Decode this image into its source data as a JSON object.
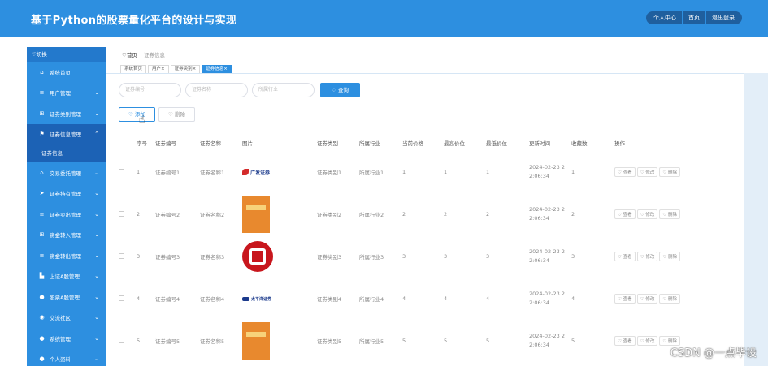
{
  "header": {
    "title": "基于Python的股票量化平台的设计与实现",
    "actions": [
      "个人中心",
      "首页",
      "退出登录"
    ]
  },
  "sidebar": {
    "switch_label": "♡切换",
    "items": [
      {
        "label": "系统首页",
        "icon": "home-icon"
      },
      {
        "label": "用户管理",
        "icon": "list-icon"
      },
      {
        "label": "证券类别管理",
        "icon": "grid-icon"
      },
      {
        "label": "证券信息管理",
        "icon": "flag-icon",
        "active": true
      },
      {
        "label": "交易委托管理",
        "icon": "bank-icon"
      },
      {
        "label": "证券持有管理",
        "icon": "send-icon"
      },
      {
        "label": "证券卖出管理",
        "icon": "list-icon"
      },
      {
        "label": "资金转入管理",
        "icon": "grid-icon"
      },
      {
        "label": "资金转出管理",
        "icon": "list-icon"
      },
      {
        "label": "上证A股管理",
        "icon": "chart-icon"
      },
      {
        "label": "股票A股管理",
        "icon": "user-icon"
      },
      {
        "label": "交流社区",
        "icon": "pin-icon"
      },
      {
        "label": "系统管理",
        "icon": "user-icon"
      },
      {
        "label": "个人资料",
        "icon": "user-icon"
      }
    ],
    "sub_item": "证券信息"
  },
  "breadcrumb": {
    "home": "♡首页",
    "current": "证券信息"
  },
  "tabs": [
    "系统首页",
    "用户×",
    "证券类别×",
    "证券信息×"
  ],
  "search": {
    "code_placeholder": "证券编号",
    "name_placeholder": "证券名称",
    "industry_placeholder": "所属行业",
    "query_label": "♡ 查询"
  },
  "actions": {
    "add_label": "♡ 添加",
    "delete_label": "♡ 删除"
  },
  "table": {
    "headers": [
      "序号",
      "证券编号",
      "证券名称",
      "图片",
      "证券类别",
      "所属行业",
      "当前价格",
      "最高价位",
      "最低价位",
      "更新时间",
      "收藏数",
      "操作"
    ],
    "op_labels": [
      "♡ 查看",
      "♡ 修改",
      "♡ 删除"
    ],
    "rows": [
      {
        "idx": "1",
        "code": "证券编号1",
        "name": "证券名称1",
        "image": "guangfa-logo",
        "logo_text": "广发证券",
        "category": "证券类别1",
        "industry": "所属行业1",
        "price": "1",
        "high": "1",
        "low": "1",
        "time1": "2024-02-23 2",
        "time2": "2:06:34",
        "fav": "1"
      },
      {
        "idx": "2",
        "code": "证券编号2",
        "name": "证券名称2",
        "image": "book-cover",
        "logo_text": "",
        "category": "证券类别2",
        "industry": "所属行业2",
        "price": "2",
        "high": "2",
        "low": "2",
        "time1": "2024-02-23 2",
        "time2": "2:06:34",
        "fav": "2"
      },
      {
        "idx": "3",
        "code": "证券编号3",
        "name": "证券名称3",
        "image": "citic-logo",
        "logo_text": "",
        "category": "证券类别3",
        "industry": "所属行业3",
        "price": "3",
        "high": "3",
        "low": "3",
        "time1": "2024-02-23 2",
        "time2": "2:06:34",
        "fav": "3"
      },
      {
        "idx": "4",
        "code": "证券编号4",
        "name": "证券名称4",
        "image": "pacific-logo",
        "logo_text": "太平洋证券",
        "category": "证券类别4",
        "industry": "所属行业4",
        "price": "4",
        "high": "4",
        "low": "4",
        "time1": "2024-02-23 2",
        "time2": "2:06:34",
        "fav": "4"
      },
      {
        "idx": "5",
        "code": "证券编号5",
        "name": "证券名称5",
        "image": "book-cover",
        "logo_text": "",
        "category": "证券类别5",
        "industry": "所属行业5",
        "price": "5",
        "high": "5",
        "low": "5",
        "time1": "2024-02-23 2",
        "time2": "2:06:34",
        "fav": "5"
      }
    ]
  },
  "watermark": "CSDN @一点毕设",
  "colors": {
    "primary": "#2d8fe0",
    "sidebar_active": "#1c62b5",
    "top_button": "#1f5f9e"
  }
}
